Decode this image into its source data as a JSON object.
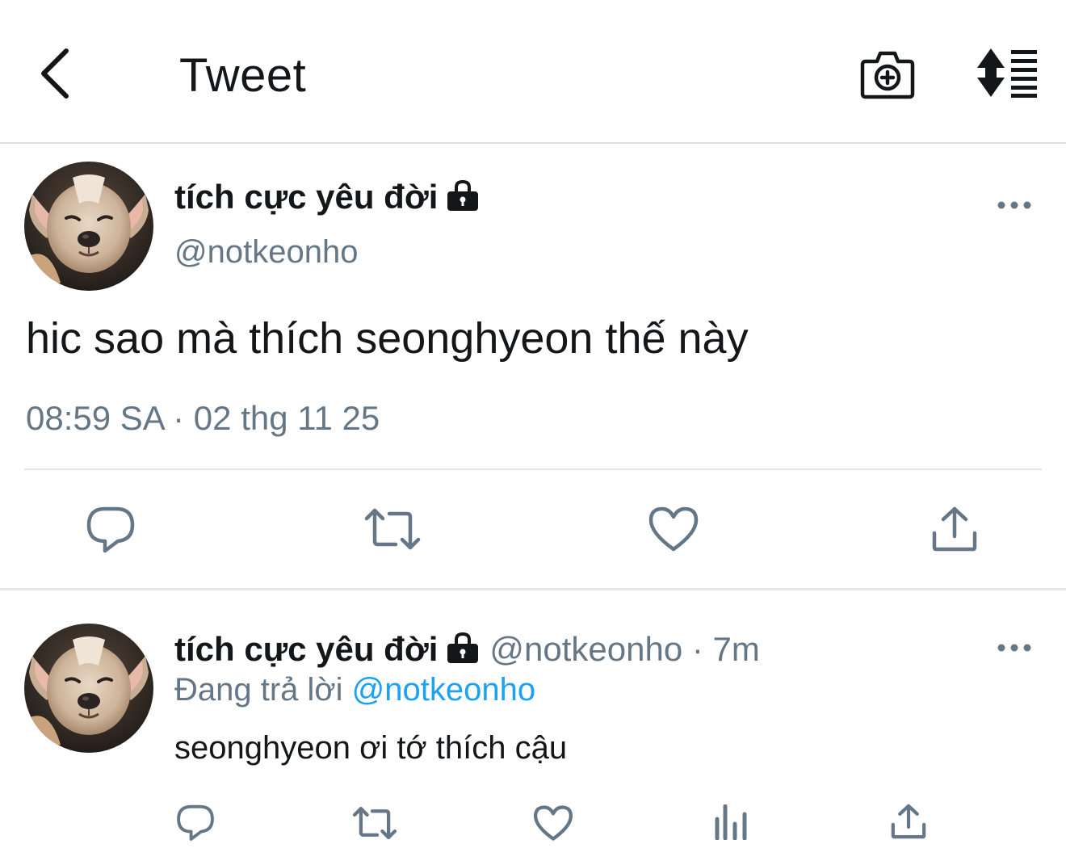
{
  "header": {
    "title": "Tweet",
    "back_icon": "chevron-left-icon",
    "camera_icon": "camera-add-icon",
    "sort_icon": "sort-list-icon"
  },
  "main_tweet": {
    "display_name": "tích cực yêu đời",
    "handle": "@notkeonho",
    "text": "hic sao mà thích seonghyeon thế này",
    "timestamp": "08:59 SA · 02 thg 11 25",
    "protected_icon": "lock-icon",
    "actions": [
      "reply-icon",
      "retweet-icon",
      "like-icon",
      "share-icon"
    ]
  },
  "reply_tweet": {
    "display_name": "tích cực yêu đời",
    "handle_time": "@notkeonho · 7m",
    "replying_prefix": "Đang trả lời",
    "replying_to": "@notkeonho",
    "text": "seonghyeon ơi tớ thích cậu",
    "actions": [
      "reply-icon",
      "retweet-icon",
      "like-icon",
      "analytics-icon",
      "share-icon"
    ]
  },
  "colors": {
    "text_primary": "#14171a",
    "text_secondary": "#657786",
    "link": "#1da1f2",
    "icon": "#657786",
    "divider": "#e1e5e8"
  }
}
